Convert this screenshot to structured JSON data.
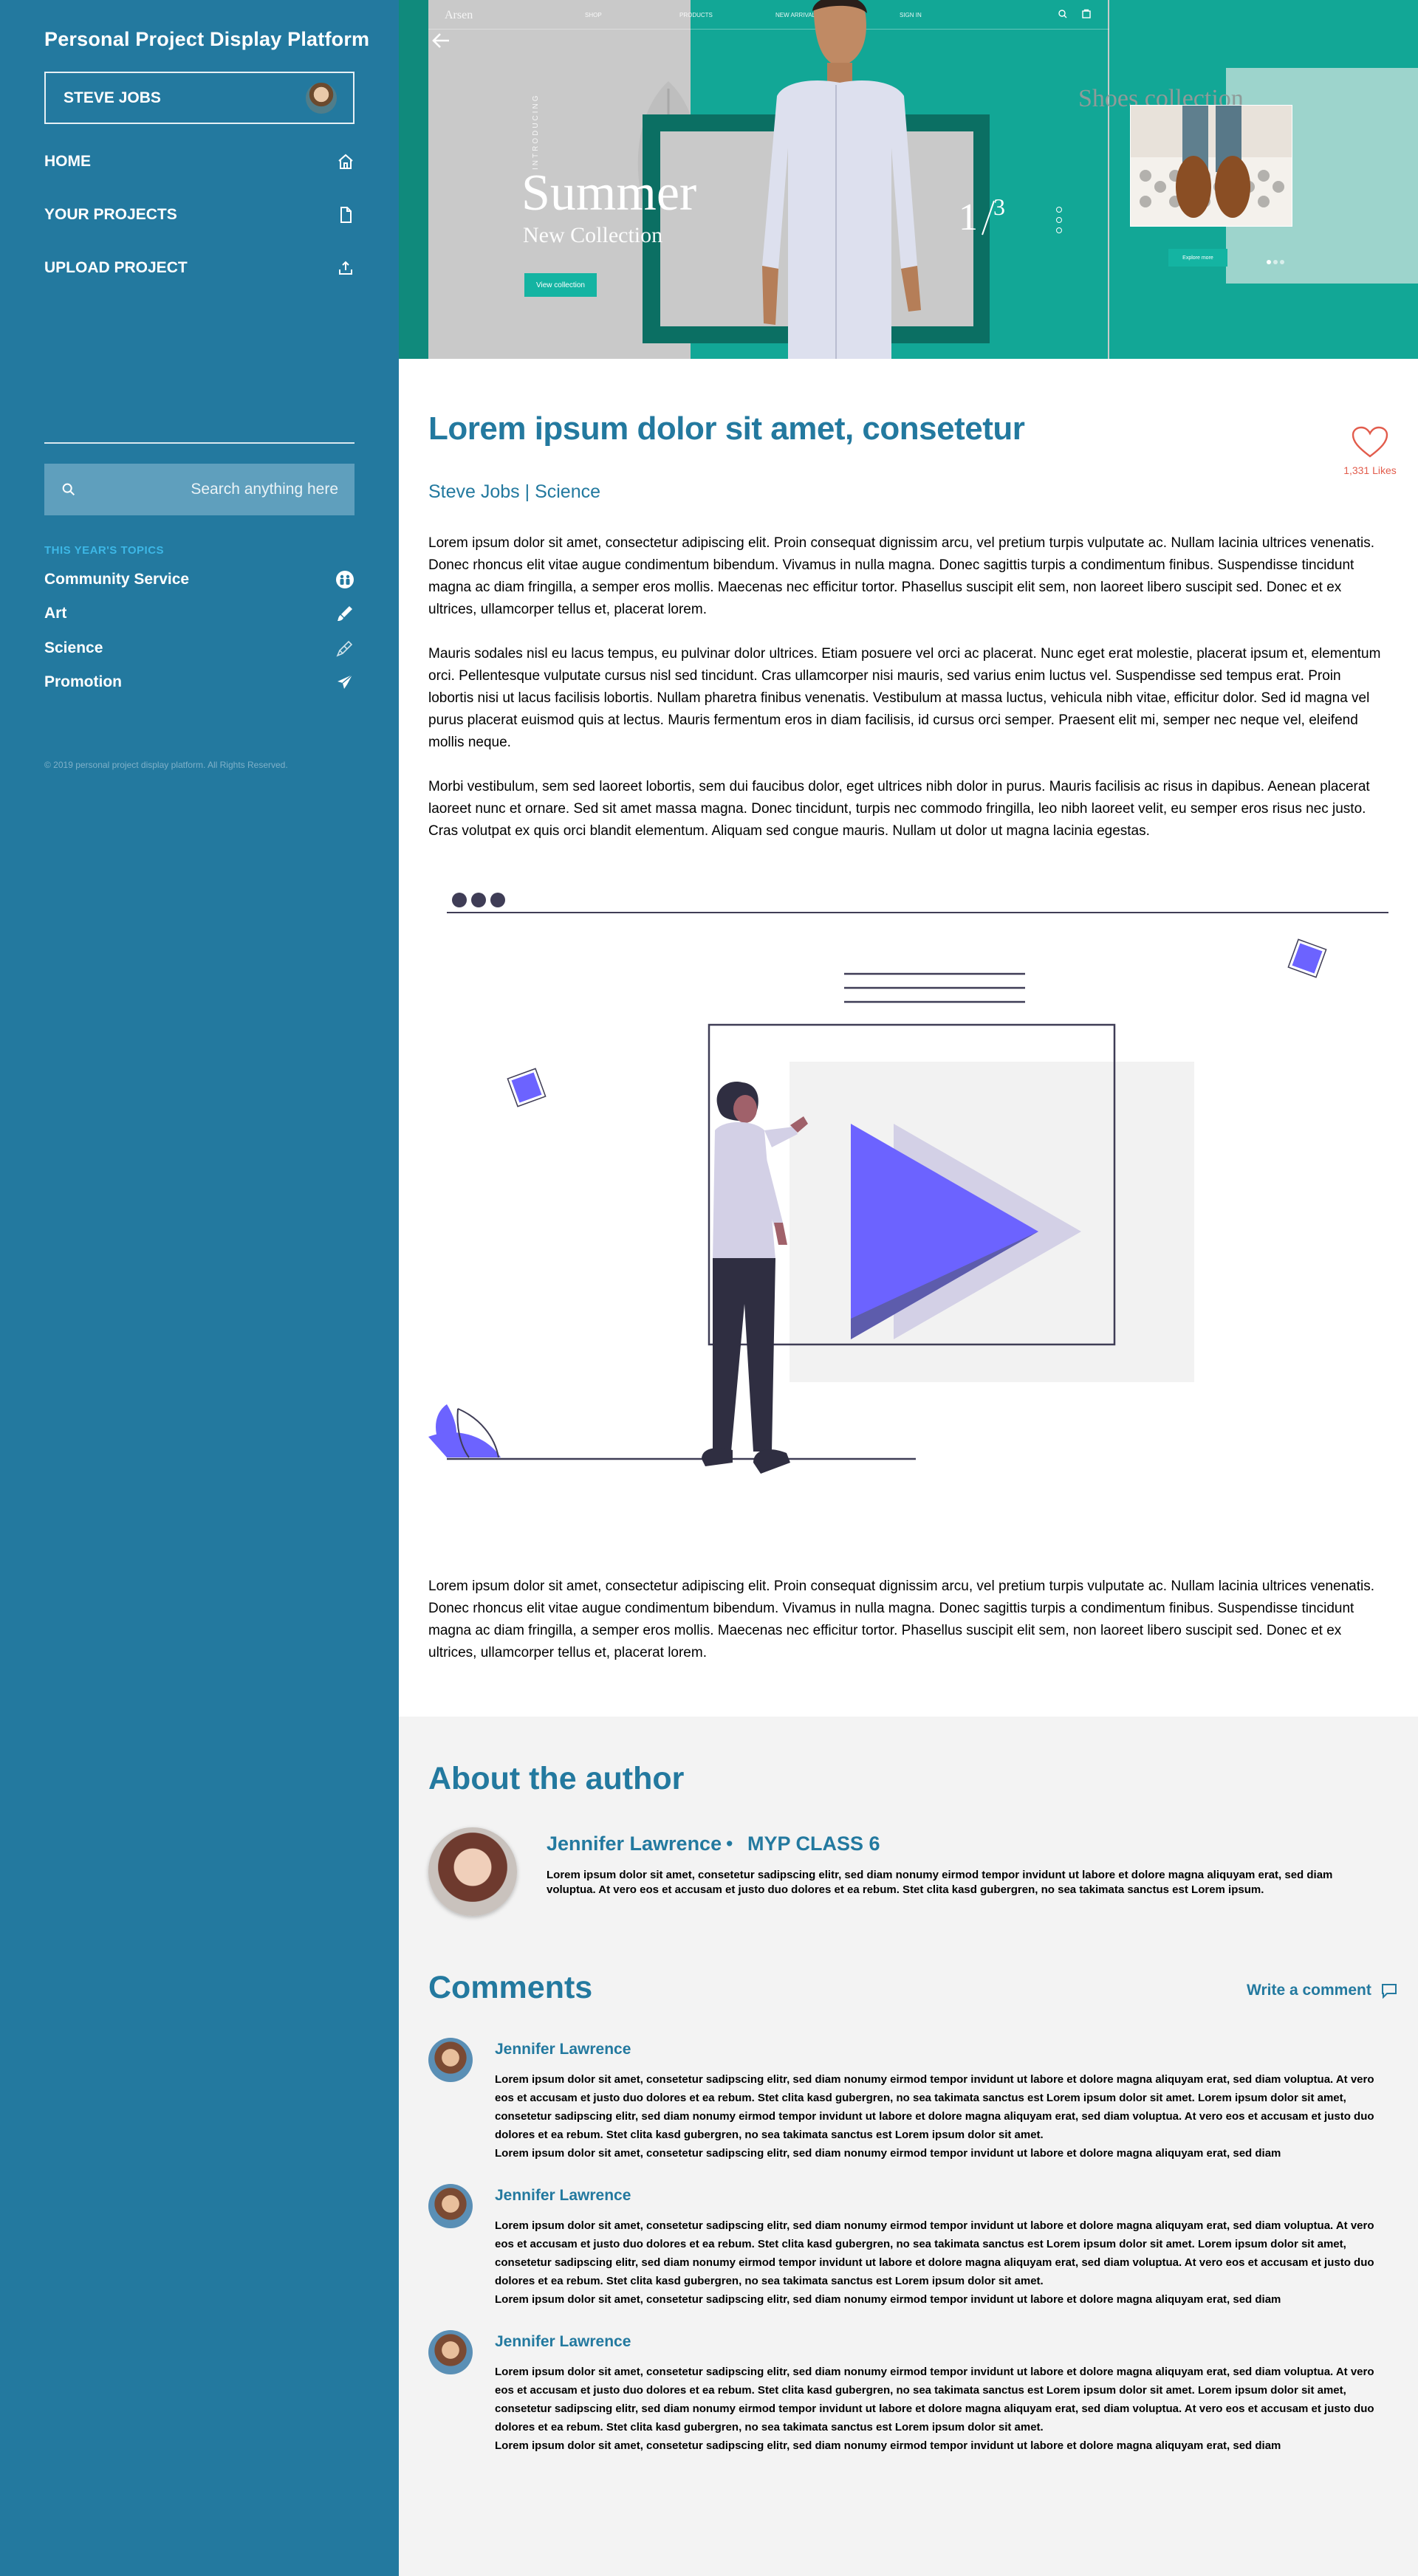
{
  "sidebar": {
    "brand": "Personal Project Display Platform",
    "user_name": "STEVE JOBS",
    "nav": [
      {
        "label": "HOME",
        "icon": "home-icon"
      },
      {
        "label": "YOUR PROJECTS",
        "icon": "file-icon"
      },
      {
        "label": "UPLOAD PROJECT",
        "icon": "upload-icon"
      }
    ],
    "search_placeholder": "Search anything here",
    "topics_title": "THIS YEAR'S TOPICS",
    "topics": [
      {
        "label": "Community Service",
        "icon": "people-icon"
      },
      {
        "label": "Art",
        "icon": "paint-icon"
      },
      {
        "label": "Science",
        "icon": "science-icon"
      },
      {
        "label": "Promotion",
        "icon": "paper-plane-icon"
      }
    ],
    "copyright": "© 2019 personal project display platform. All Rights Reserved."
  },
  "hero": {
    "logo": "Arsen",
    "links": [
      "SHOP",
      "PRODUCTS",
      "NEW ARRIVALS",
      "SIGN IN"
    ],
    "introducing": "INTRODUCING",
    "headline": "Summer",
    "subline": "New Collection",
    "button": "View collection",
    "page_num": "1",
    "page_total": "3",
    "shoes_title": "Shoes collection",
    "shoes_button": "Explore more"
  },
  "article": {
    "title": "Lorem ipsum dolor sit amet, consetetur",
    "likes": "1,331 Likes",
    "byline": "Steve Jobs | Science",
    "paragraphs": [
      "Lorem ipsum dolor sit amet, consectetur adipiscing elit. Proin consequat dignissim arcu, vel pretium turpis vulputate ac. Nullam lacinia ultrices venenatis. Donec rhoncus elit vitae augue condimentum bibendum. Vivamus in nulla magna. Donec sagittis turpis a condimentum finibus. Suspendisse tincidunt magna ac diam fringilla, a semper eros mollis. Maecenas nec efficitur tortor. Phasellus suscipit elit sem, non laoreet libero suscipit sed. Donec et ex ultrices, ullamcorper tellus et, placerat lorem.",
      "Mauris sodales nisl eu lacus tempus, eu pulvinar dolor ultrices. Etiam posuere vel orci ac placerat. Nunc eget erat molestie, placerat ipsum et, elementum orci. Pellentesque vulputate cursus nisl sed tincidunt. Cras ullamcorper nisi mauris, sed varius enim luctus vel. Suspendisse sed tempus erat. Proin lobortis nisi ut lacus facilisis lobortis. Nullam pharetra finibus venenatis. Vestibulum at massa luctus, vehicula nibh vitae, efficitur dolor. Sed id magna vel purus placerat euismod quis at lectus. Mauris fermentum eros in diam facilisis, id cursus orci semper. Praesent elit mi, semper nec neque vel, eleifend mollis neque.",
      "Morbi vestibulum, sem sed laoreet lobortis, sem dui faucibus dolor, eget ultrices nibh dolor in purus. Mauris facilisis ac risus in dapibus. Aenean placerat laoreet nunc et ornare. Sed sit amet massa magna. Donec tincidunt, turpis nec commodo fringilla, leo nibh laoreet velit, eu semper eros risus nec justo. Cras volutpat ex quis orci blandit elementum. Aliquam sed congue mauris. Nullam ut dolor ut magna lacinia egestas.",
      "Lorem ipsum dolor sit amet, consectetur adipiscing elit. Proin consequat dignissim arcu, vel pretium turpis vulputate ac. Nullam lacinia ultrices venenatis. Donec rhoncus elit vitae augue condimentum bibendum. Vivamus in nulla magna. Donec sagittis turpis a condimentum finibus. Suspendisse tincidunt magna ac diam fringilla, a semper eros mollis. Maecenas nec efficitur tortor. Phasellus suscipit elit sem, non laoreet libero suscipit sed. Donec et ex ultrices, ullamcorper tellus et, placerat lorem."
    ]
  },
  "about": {
    "title": "About the author",
    "name": "Jennifer Lawrence",
    "separator": "•",
    "class": "MYP CLASS 6",
    "bio": "Lorem ipsum dolor sit amet, consetetur sadipscing elitr, sed diam nonumy eirmod tempor invidunt ut labore et dolore magna aliquyam erat, sed diam voluptua. At vero eos et accusam et justo duo dolores et ea rebum. Stet clita kasd gubergren, no sea takimata sanctus est Lorem ipsum."
  },
  "comments": {
    "title": "Comments",
    "write_label": "Write a comment",
    "items": [
      {
        "name": "Jennifer Lawrence",
        "text": "Lorem ipsum dolor sit amet, consetetur sadipscing elitr, sed diam nonumy eirmod tempor invidunt ut labore et dolore magna aliquyam erat, sed diam voluptua. At vero eos et accusam et justo duo dolores et ea rebum. Stet clita kasd gubergren, no sea takimata sanctus est Lorem ipsum dolor sit amet. Lorem ipsum dolor sit amet, consetetur sadipscing elitr, sed diam nonumy eirmod tempor invidunt ut labore et dolore magna aliquyam erat, sed diam voluptua. At vero eos et accusam et justo duo dolores et ea rebum. Stet clita kasd gubergren, no sea takimata sanctus est Lorem ipsum dolor sit amet.",
        "text2": "Lorem ipsum dolor sit amet, consetetur sadipscing elitr, sed diam nonumy eirmod tempor invidunt ut labore et dolore magna aliquyam erat, sed diam"
      },
      {
        "name": "Jennifer Lawrence",
        "text": "Lorem ipsum dolor sit amet, consetetur sadipscing elitr, sed diam nonumy eirmod tempor invidunt ut labore et dolore magna aliquyam erat, sed diam voluptua. At vero eos et accusam et justo duo dolores et ea rebum. Stet clita kasd gubergren, no sea takimata sanctus est Lorem ipsum dolor sit amet. Lorem ipsum dolor sit amet, consetetur sadipscing elitr, sed diam nonumy eirmod tempor invidunt ut labore et dolore magna aliquyam erat, sed diam voluptua. At vero eos et accusam et justo duo dolores et ea rebum. Stet clita kasd gubergren, no sea takimata sanctus est Lorem ipsum dolor sit amet.",
        "text2": "Lorem ipsum dolor sit amet, consetetur sadipscing elitr, sed diam nonumy eirmod tempor invidunt ut labore et dolore magna aliquyam erat, sed diam"
      },
      {
        "name": "Jennifer Lawrence",
        "text": "Lorem ipsum dolor sit amet, consetetur sadipscing elitr, sed diam nonumy eirmod tempor invidunt ut labore et dolore magna aliquyam erat, sed diam voluptua. At vero eos et accusam et justo duo dolores et ea rebum. Stet clita kasd gubergren, no sea takimata sanctus est Lorem ipsum dolor sit amet. Lorem ipsum dolor sit amet, consetetur sadipscing elitr, sed diam nonumy eirmod tempor invidunt ut labore et dolore magna aliquyam erat, sed diam voluptua. At vero eos et accusam et justo duo dolores et ea rebum. Stet clita kasd gubergren, no sea takimata sanctus est Lorem ipsum dolor sit amet.",
        "text2": "Lorem ipsum dolor sit amet, consetetur sadipscing elitr, sed diam nonumy eirmod tempor invidunt ut labore et dolore magna aliquyam erat, sed diam"
      }
    ]
  },
  "colors": {
    "sidebar": "#23799f",
    "accent": "#23799f",
    "like": "#e25c4c",
    "illustration_purple": "#6c63ff",
    "hero_teal": "#12a796"
  }
}
